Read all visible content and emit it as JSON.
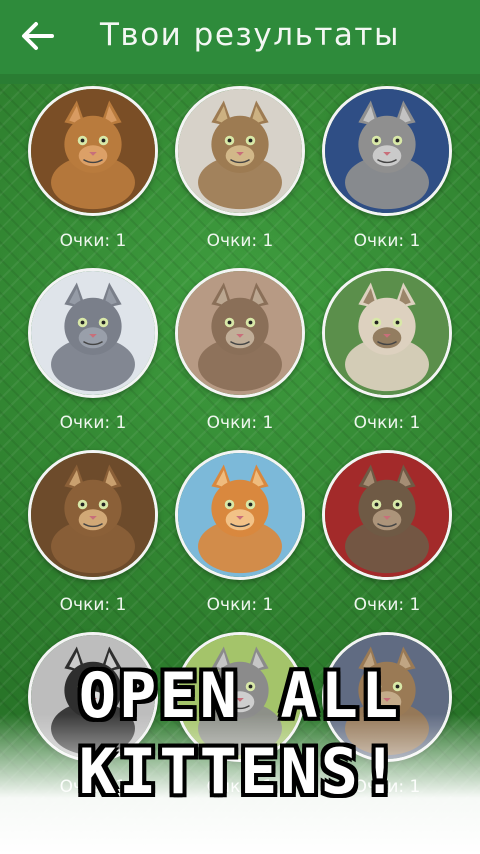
{
  "header": {
    "title": "Твои результаты"
  },
  "kittens": [
    {
      "score_label": "Очки: 1",
      "color": "#b97b3d",
      "accent": "#e0a46b",
      "background": "#7a4e26"
    },
    {
      "score_label": "Очки: 1",
      "color": "#9d7b52",
      "accent": "#d8bf8f",
      "background": "#d7d2c9"
    },
    {
      "score_label": "Очки: 1",
      "color": "#8f8f8f",
      "accent": "#d0d0d0",
      "background": "#2f4e85"
    },
    {
      "score_label": "Очки: 1",
      "color": "#7a7f8a",
      "accent": "#9ca3ad",
      "background": "#dfe4ea"
    },
    {
      "score_label": "Очки: 1",
      "color": "#8a6f58",
      "accent": "#c7b5a0",
      "background": "#b79a84"
    },
    {
      "score_label": "Очки: 1",
      "color": "#ddd1bf",
      "accent": "#8b7355",
      "background": "#5b8f4b"
    },
    {
      "score_label": "Очки: 1",
      "color": "#8b6038",
      "accent": "#d8b07d",
      "background": "#6d4b2b"
    },
    {
      "score_label": "Очки: 1",
      "color": "#d9883e",
      "accent": "#f4c98f",
      "background": "#7cb9d9"
    },
    {
      "score_label": "Очки: 1",
      "color": "#6f5a45",
      "accent": "#b39a7f",
      "background": "#a32a2a"
    },
    {
      "score_label": "Очки: 1",
      "color": "#2e2e2e",
      "accent": "#f2f2f2",
      "background": "#bdbdbd"
    },
    {
      "score_label": "Очки: 1",
      "color": "#8b8b8b",
      "accent": "#d5d5d5",
      "background": "#a4c46a"
    },
    {
      "score_label": "Очки: 1",
      "color": "#9a7a55",
      "accent": "#c9b08f",
      "background": "#606b82"
    }
  ],
  "cta": {
    "line1": "OPEN ALL",
    "line2": "KITTENS!"
  }
}
